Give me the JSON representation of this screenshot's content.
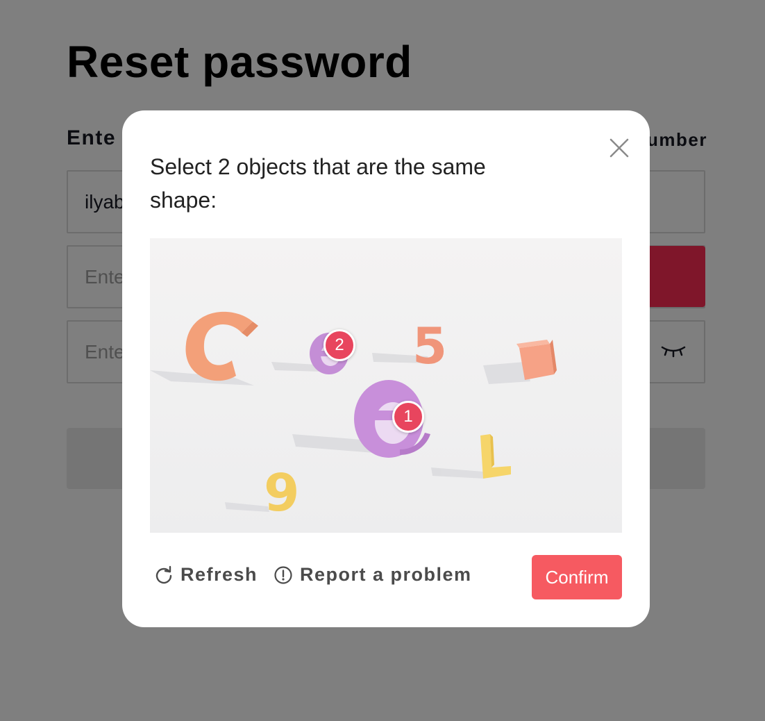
{
  "page": {
    "title": "Reset password",
    "field_label": "Ente",
    "field_label_right": "umber",
    "email_value": "ilyab",
    "code_placeholder": "Ente",
    "password_placeholder": "Ente",
    "send_button_color": "#fe2c55",
    "password_visibility_icon": "eye-closed-icon"
  },
  "captcha": {
    "prompt": "Select 2 objects that are the same shape:",
    "close_icon": "close-icon",
    "objects": [
      "C",
      "e",
      "5",
      "cube",
      "e",
      "9",
      "L"
    ],
    "markers": [
      "1",
      "2"
    ],
    "refresh_label": "Refresh",
    "report_label": "Report a problem",
    "confirm_label": "Confirm",
    "confirm_color": "#f65a61",
    "marker_color": "#e8455e"
  }
}
